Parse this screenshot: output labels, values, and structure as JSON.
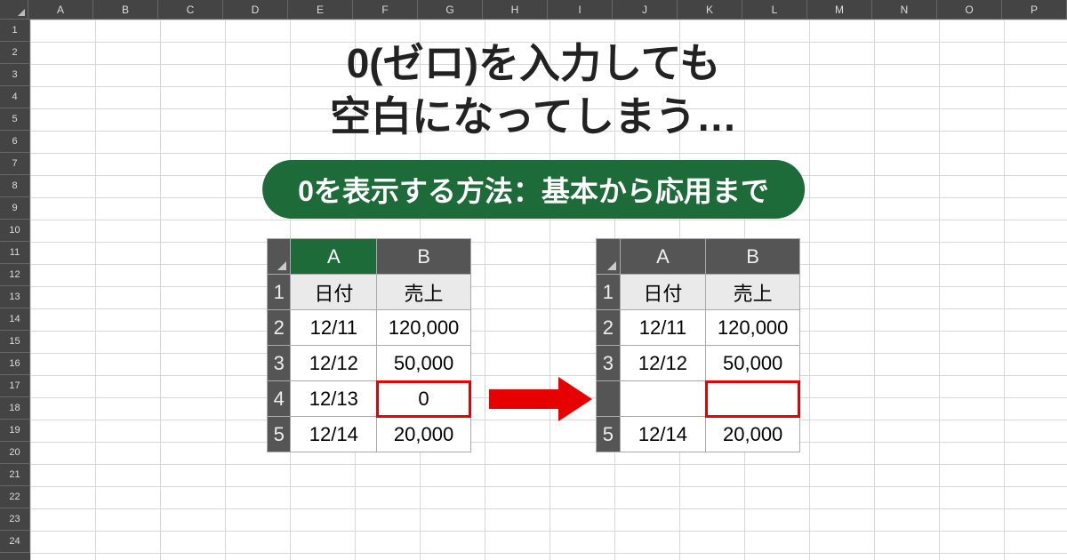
{
  "background": {
    "columns": [
      "A",
      "B",
      "C",
      "D",
      "E",
      "F",
      "G",
      "H",
      "I",
      "J",
      "K",
      "L",
      "M",
      "N",
      "O",
      "P"
    ],
    "row_count": 24
  },
  "title_line1": "0(ゼロ)を入力しても",
  "title_line2": "空白になってしまう…",
  "subtitle": "0を表示する方法：基本から応用まで",
  "left_table": {
    "col_a": "A",
    "col_b": "B",
    "col_a_selected": true,
    "header_a": "日付",
    "header_b": "売上",
    "rows": [
      {
        "n": "1",
        "a": "日付",
        "b": "売上",
        "is_header": true
      },
      {
        "n": "2",
        "a": "12/11",
        "b": "120,000"
      },
      {
        "n": "3",
        "a": "12/12",
        "b": "50,000"
      },
      {
        "n": "4",
        "a": "12/13",
        "b": "0",
        "b_highlight": true
      },
      {
        "n": "5",
        "a": "12/14",
        "b": "20,000"
      }
    ]
  },
  "right_table": {
    "col_a": "A",
    "col_b": "B",
    "rows": [
      {
        "n": "1",
        "a": "日付",
        "b": "売上",
        "is_header": true
      },
      {
        "n": "2",
        "a": "12/11",
        "b": "120,000"
      },
      {
        "n": "3",
        "a": "12/12",
        "b": "50,000"
      },
      {
        "n": "",
        "a": "",
        "b": "",
        "b_highlight": true
      },
      {
        "n": "5",
        "a": "12/14",
        "b": "20,000"
      }
    ]
  }
}
